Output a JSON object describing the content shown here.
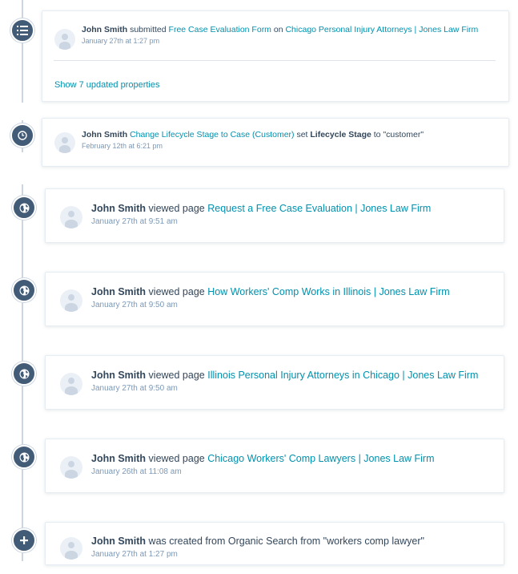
{
  "timeline": {
    "events": [
      {
        "type": "form-submission",
        "icon": "form-icon",
        "actor": "John Smith",
        "verb": "submitted",
        "target_link": "Free Case Evaluation Form",
        "connector": "on",
        "page_link": "Chicago Personal Injury Attorneys | Jones Law Firm",
        "timestamp": "January 27th at 1:27 pm",
        "show_more": "Show 7 updated properties"
      },
      {
        "type": "lifecycle-change",
        "icon": "clock-icon",
        "actor": "John Smith",
        "action_link": "Change Lifecycle Stage to Case (Customer)",
        "text_set": "set",
        "property": "Lifecycle Stage",
        "text_to": "to \"customer\"",
        "timestamp": "February 12th at 6:21 pm"
      },
      {
        "type": "page-view",
        "icon": "globe-icon",
        "actor": "John Smith",
        "verb": "viewed page",
        "page_link": "Request a Free Case Evaluation | Jones Law Firm",
        "timestamp": "January 27th at 9:51 am"
      },
      {
        "type": "page-view",
        "icon": "globe-icon",
        "actor": "John Smith",
        "verb": "viewed page",
        "page_link": "How Workers' Comp Works in Illinois | Jones Law Firm",
        "timestamp": "January 27th at 9:50 am"
      },
      {
        "type": "page-view",
        "icon": "globe-icon",
        "actor": "John Smith",
        "verb": "viewed page",
        "page_link": "Illinois Personal Injury Attorneys in Chicago | Jones Law Firm",
        "timestamp": "January 27th at 9:50 am"
      },
      {
        "type": "page-view",
        "icon": "globe-icon",
        "actor": "John Smith",
        "verb": "viewed page",
        "page_link": "Chicago Workers' Comp Lawyers | Jones Law Firm",
        "timestamp": "January 26th at 11:08 am"
      },
      {
        "type": "contact-created",
        "icon": "plus-icon",
        "actor": "John Smith",
        "text": "was created from Organic Search from \"workers comp lawyer\"",
        "timestamp": "January 27th at 1:27 pm"
      }
    ]
  },
  "colors": {
    "link": "#0091ae",
    "text": "#33475b",
    "timestamp": "#7c98b6",
    "timeline_dot": "#425b76",
    "timeline_line": "#cbd6e2"
  }
}
